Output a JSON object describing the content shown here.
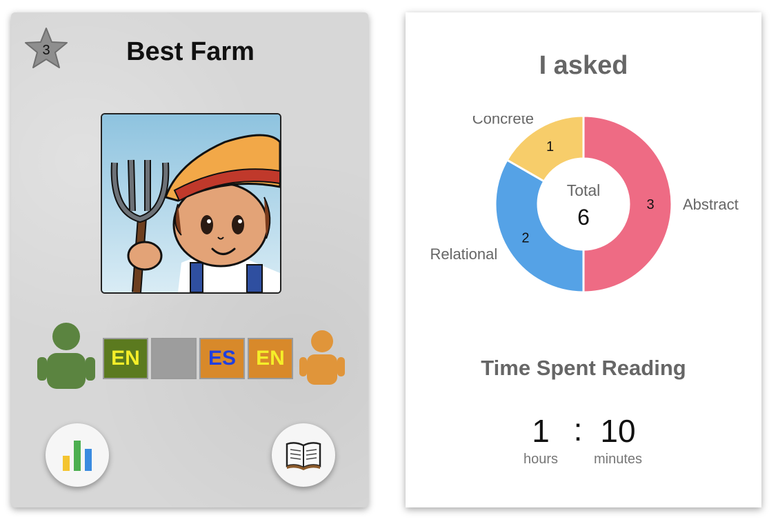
{
  "card": {
    "star_count": "3",
    "title": "Best Farm",
    "portrait_icon": "farmer-with-pitchfork",
    "languages": [
      {
        "label": "EN",
        "bg": "#5b7a1f",
        "fg": "#f5ee29"
      },
      {
        "label": "",
        "bg": "#9d9d9d",
        "fg": "#000000"
      },
      {
        "label": "ES",
        "bg": "#d8892a",
        "fg": "#1f3fe0"
      },
      {
        "label": "EN",
        "bg": "#d8892a",
        "fg": "#f5ee29"
      }
    ],
    "left_person_color": "#5b8440",
    "right_person_color": "#e0953a",
    "buttons": {
      "stats_icon": "bar-chart-icon",
      "read_icon": "open-book-icon"
    }
  },
  "panel": {
    "title": "I asked",
    "time_title": "Time Spent Reading",
    "hours_value": "1",
    "separator": ":",
    "minutes_value": "10",
    "hours_label": "hours",
    "minutes_label": "minutes"
  },
  "chart_data": {
    "type": "pie",
    "categories": [
      "Abstract",
      "Relational",
      "Concrete"
    ],
    "values": [
      3,
      2,
      1
    ],
    "colors": [
      "#ee6b84",
      "#55a2e6",
      "#f7cd6a"
    ],
    "center_label": "Total",
    "center_value": "6"
  }
}
